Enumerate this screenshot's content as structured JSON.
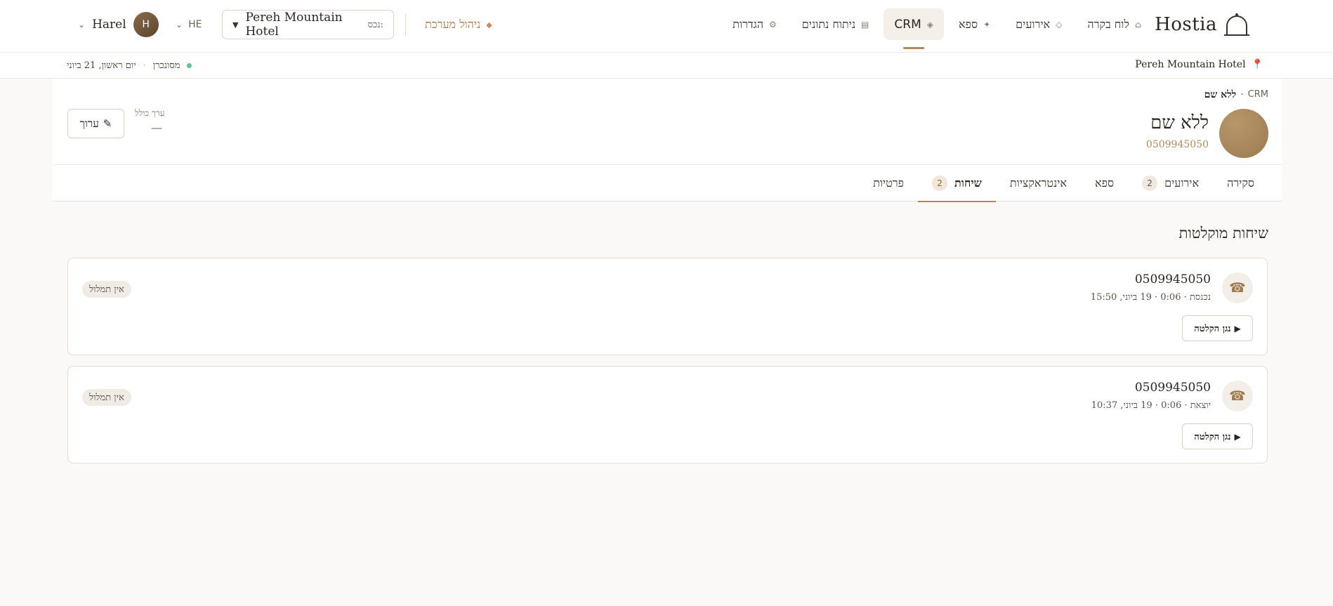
{
  "app": {
    "name": "Hostia",
    "logo_icon": "bell-dome-icon"
  },
  "nav": {
    "items": [
      {
        "label": "לוח בקרה",
        "glyph": "⌂",
        "icon": "home-icon"
      },
      {
        "label": "אירועים",
        "glyph": "◇",
        "icon": "diamond-icon"
      },
      {
        "label": "ספא",
        "glyph": "✦",
        "icon": "sparkle-icon"
      },
      {
        "label": "CRM",
        "glyph": "◈",
        "icon": "crm-icon",
        "active": true
      },
      {
        "label": "ניתוח נתונים",
        "glyph": "▤",
        "icon": "chart-icon"
      },
      {
        "label": "הגדרות",
        "glyph": "⚙",
        "icon": "gear-icon"
      }
    ],
    "admin": {
      "label": "ניהול מערכת",
      "glyph": "◆"
    }
  },
  "property_select": {
    "label": "נכס:",
    "value": "Pereh Mountain Hotel",
    "arrow": "▼"
  },
  "language": {
    "value": "HE",
    "chevron": "⌄"
  },
  "user": {
    "name": "Harel",
    "initial": "H",
    "chevron": "⌄"
  },
  "subbar": {
    "hotel": "Pereh Mountain Hotel",
    "pin_glyph": "📍",
    "sync_status": "מסונכרן",
    "separator": "·",
    "date": "יום ראשון, 21 ביוני"
  },
  "breadcrumb": {
    "root": "CRM",
    "separator": "·",
    "current": "ללא שם"
  },
  "profile": {
    "name": "ללא שם",
    "phone": "0509945050",
    "total_label": "ערך כולל",
    "total_value": "—",
    "edit_label": "ערוך",
    "edit_glyph": "✎"
  },
  "tabs": [
    {
      "label": "סקירה"
    },
    {
      "label": "אירועים",
      "count": "2"
    },
    {
      "label": "ספא"
    },
    {
      "label": "אינטראקציות"
    },
    {
      "label": "שיחות",
      "count": "2",
      "active": true
    },
    {
      "label": "פרטיות"
    }
  ],
  "calls": {
    "title": "שיחות מוקלטות",
    "items": [
      {
        "number": "0509945050",
        "meta": "נכנסת · 0:06 · 19 ביוני, 15:50",
        "transcript_status": "אין תמלול",
        "play_label": "נגן הקלטה",
        "play_glyph": "▶",
        "icon_glyph": "☎"
      },
      {
        "number": "0509945050",
        "meta": "יוצאת · 0:06 · 19 ביוני, 10:37",
        "transcript_status": "אין תמלול",
        "play_label": "נגן הקלטה",
        "play_glyph": "▶",
        "icon_glyph": "☎"
      }
    ]
  },
  "colors": {
    "accent": "#b38a5a",
    "admin": "#b07a45",
    "sync_dot": "#5bc49a",
    "background": "#faf9f7"
  }
}
